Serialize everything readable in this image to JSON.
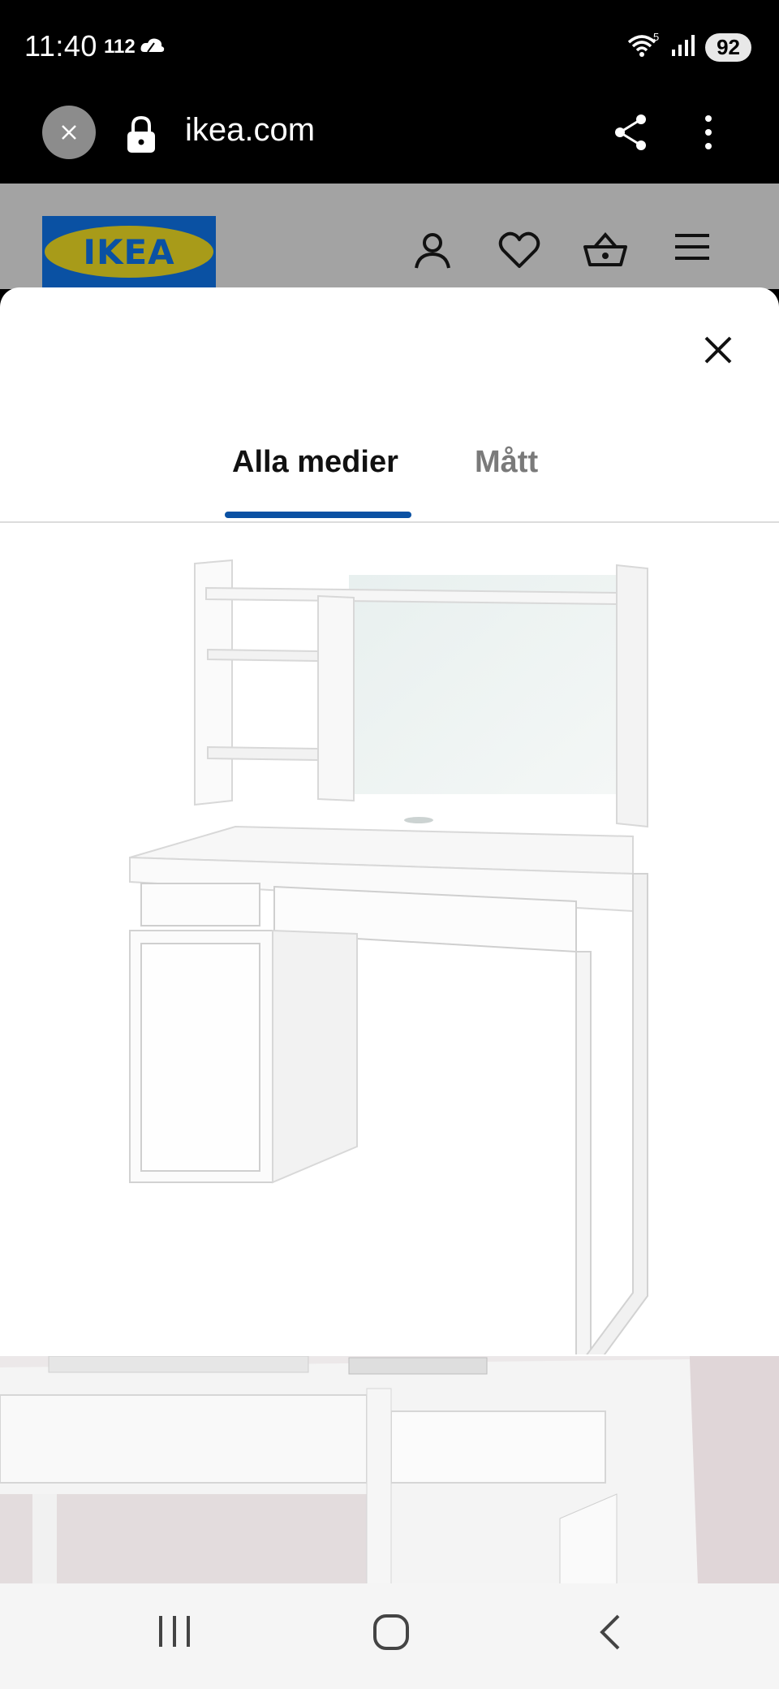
{
  "status_bar": {
    "time": "11:40",
    "extra": "112",
    "wifi_badge": "5",
    "battery": "92"
  },
  "browser": {
    "url": "ikea.com"
  },
  "header": {
    "logo_text": "IKEA"
  },
  "modal": {
    "tabs": [
      {
        "label": "Alla medier",
        "active": true
      },
      {
        "label": "Mått",
        "active": false
      }
    ]
  },
  "colors": {
    "ikea_blue": "#0a51a3",
    "ikea_yellow": "#a89b19",
    "overlay_gray": "#a3a3a3"
  },
  "icons": [
    "close-icon",
    "lock-icon",
    "share-icon",
    "more-vert-icon",
    "account-icon",
    "heart-icon",
    "basket-icon",
    "menu-icon",
    "recent-apps-icon",
    "home-icon",
    "back-icon"
  ]
}
